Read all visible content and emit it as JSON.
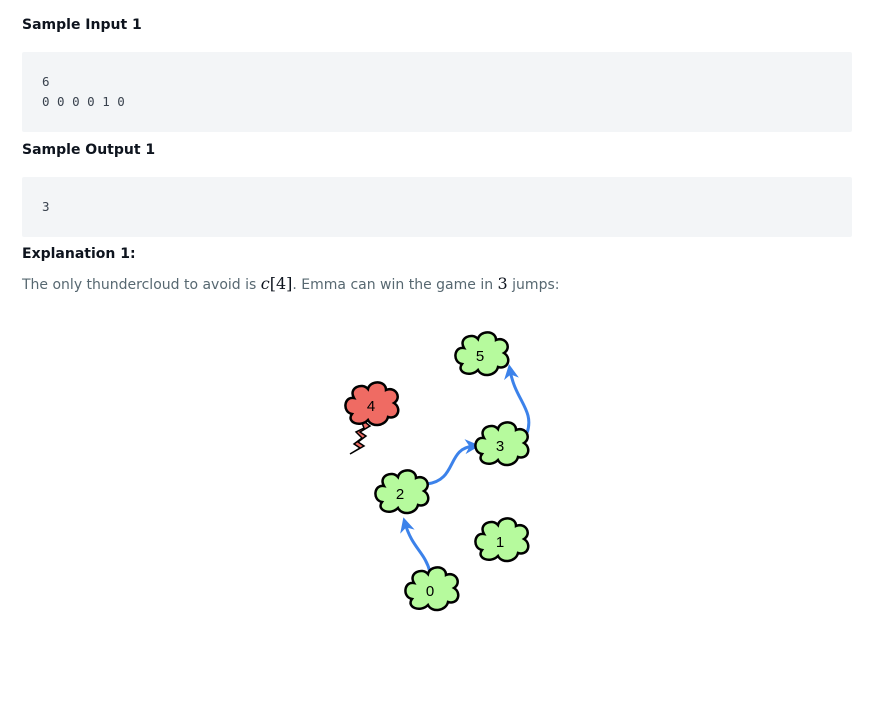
{
  "sample_input": {
    "heading": "Sample Input 1",
    "lines": [
      "6",
      "0 0 0 0 1 0"
    ]
  },
  "sample_output": {
    "heading": "Sample Output 1",
    "lines": [
      "3"
    ]
  },
  "explanation": {
    "heading": "Explanation 1:",
    "text_before": "The only thundercloud to avoid is ",
    "math_var": "c",
    "math_index": "[4]",
    "text_middle": ". Emma can win the game in ",
    "math_jumps": "3",
    "text_after": " jumps:"
  },
  "diagram": {
    "clouds": [
      {
        "label": "0",
        "type": "cumulus"
      },
      {
        "label": "1",
        "type": "cumulus"
      },
      {
        "label": "2",
        "type": "cumulus"
      },
      {
        "label": "3",
        "type": "cumulus"
      },
      {
        "label": "4",
        "type": "thunderhead"
      },
      {
        "label": "5",
        "type": "cumulus"
      }
    ],
    "path": [
      "0",
      "2",
      "3",
      "5"
    ],
    "colors": {
      "cumulus": "#b6fa9d",
      "thunderhead": "#ef6b63",
      "arrow": "#3c82ea",
      "outline": "#000000"
    }
  }
}
